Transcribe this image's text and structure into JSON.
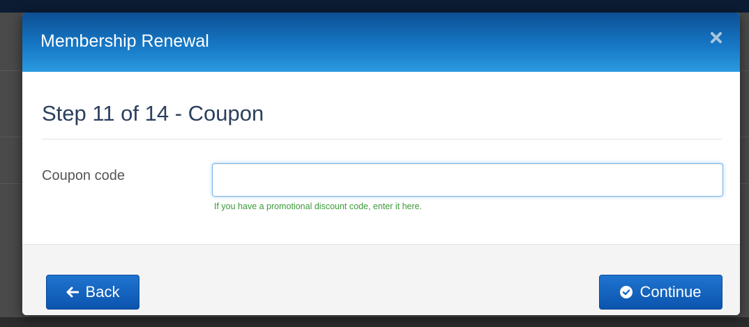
{
  "modal": {
    "title": "Membership Renewal",
    "close_icon": "close-icon"
  },
  "step": {
    "title": "Step 11 of 14 - Coupon"
  },
  "form": {
    "coupon_label": "Coupon code",
    "coupon_value": "",
    "coupon_help": "If you have a promotional discount code, enter it here."
  },
  "footer": {
    "back_label": "Back",
    "back_icon": "arrow-left-icon",
    "continue_label": "Continue",
    "continue_icon": "check-circle-icon"
  },
  "colors": {
    "header_gradient_top": "#0c4f94",
    "header_gradient_bottom": "#2a9ae0",
    "button_blue": "#1566c3",
    "help_text_green": "#3a9a3a",
    "step_title": "#2b3f5c"
  }
}
